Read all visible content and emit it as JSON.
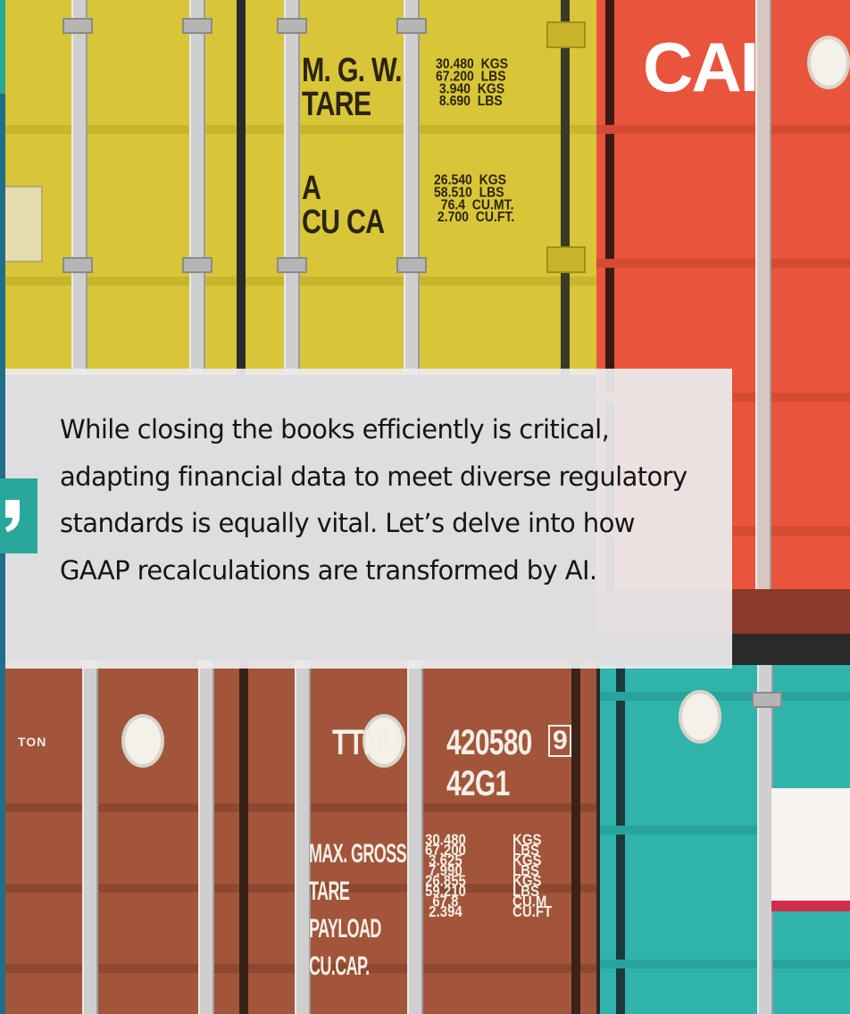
{
  "quote": {
    "text": "While closing the books efficiently is critical, adapting financial data to meet diverse regulatory standards is equally vital. Let’s delve into how GAAP recalculations are transformed by AI."
  },
  "background_image": {
    "yellow_container_markings": {
      "label_top": "M. G. W.\nTARE",
      "values_top": "30.480  KGS\n67.200  LBS\n 3.940  KGS\n 8.690  LBS",
      "label_bottom": "A\nCU CA",
      "values_bottom": "26.540  KGS\n58.510  LBS\n  76.4  CU.MT.\n 2.700  CU.FT."
    },
    "red_container_logo": "CAI",
    "brown_container_markings": {
      "code": "TTNU",
      "number": "420580",
      "check_digit": "9",
      "type_code": "42G1",
      "labels": "MAX. GROSS\nTARE\nPAYLOAD\nCU.CAP.",
      "values": "30.480\n67.200\n 3.625\n 7.990\n26.855\n59.210\n  67.8\n 2.394",
      "units": "KGS\nLBS\nKGS\nLBS\nKGS\nLBS\nCU.M\nCU.FT",
      "edge_text": "TON"
    }
  },
  "colors": {
    "accent_teal": "#2aa79b",
    "accent_navy": "#1f6f8b",
    "panel_bg": "#ececee",
    "text": "#151515"
  },
  "icons": {
    "quote_badge": "quote-mark-icon"
  }
}
